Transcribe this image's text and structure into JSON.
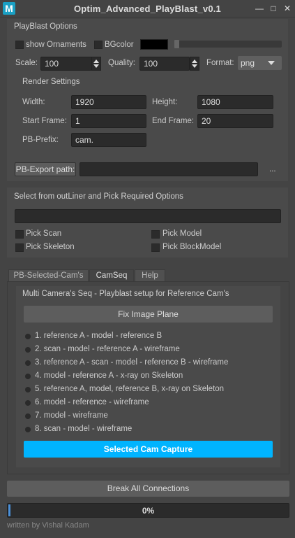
{
  "window": {
    "app_icon_letter": "M",
    "title": "Optim_Advanced_PlayBlast_v0.1",
    "minimize_glyph": "—",
    "float_glyph": "□",
    "close_glyph": "✕"
  },
  "playblast_options": {
    "section_label": "PlayBlast Options",
    "show_ornaments_label": "show Ornaments",
    "bgcolor_label": "BGcolor",
    "bgcolor_swatch": "#000000",
    "scale_label": "Scale:",
    "scale_value": "100",
    "quality_label": "Quality:",
    "quality_value": "100",
    "format_label": "Format:",
    "format_value": "png"
  },
  "render_settings": {
    "section_label": "Render Settings",
    "width_label": "Width:",
    "width_value": "1920",
    "height_label": "Height:",
    "height_value": "1080",
    "start_frame_label": "Start Frame:",
    "start_frame_value": "1",
    "end_frame_label": "End Frame:",
    "end_frame_value": "20",
    "prefix_label": "PB-Prefix:",
    "prefix_value": "cam.",
    "export_path_button": "PB-Export path:",
    "export_path_value": "",
    "browse_label": "..."
  },
  "outliner": {
    "section_label": "Select from outLiner and Pick Required Options",
    "selection_value": "",
    "pick_scan": "Pick Scan",
    "pick_model": "Pick Model",
    "pick_skeleton": "Pick Skeleton",
    "pick_blockmodel": "Pick BlockModel"
  },
  "tabs": {
    "items": [
      "PB-Selected-Cam's",
      "CamSeq",
      "Help"
    ],
    "active": "CamSeq"
  },
  "camseq": {
    "heading": "Multi Camera's Seq - Playblast setup for Reference Cam's",
    "fix_image_plane_button": "Fix Image Plane",
    "options": [
      "1. reference A - model - reference B",
      "2. scan - model - reference A - wireframe",
      "3. reference A - scan - model - reference B - wireframe",
      "4. model - reference A - x-ray on Skeleton",
      "5. reference A, model, reference B, x-ray on Skeleton",
      "6. model - reference - wireframe",
      "7. model - wireframe",
      "8. scan - model - wireframe"
    ],
    "capture_button": "Selected Cam Capture",
    "capture_button_color": "#00b4ff"
  },
  "footer": {
    "break_connections_button": "Break All Connections",
    "progress_text": "0%",
    "progress_fraction": 0.0,
    "credit": "written by Vishal Kadam"
  }
}
